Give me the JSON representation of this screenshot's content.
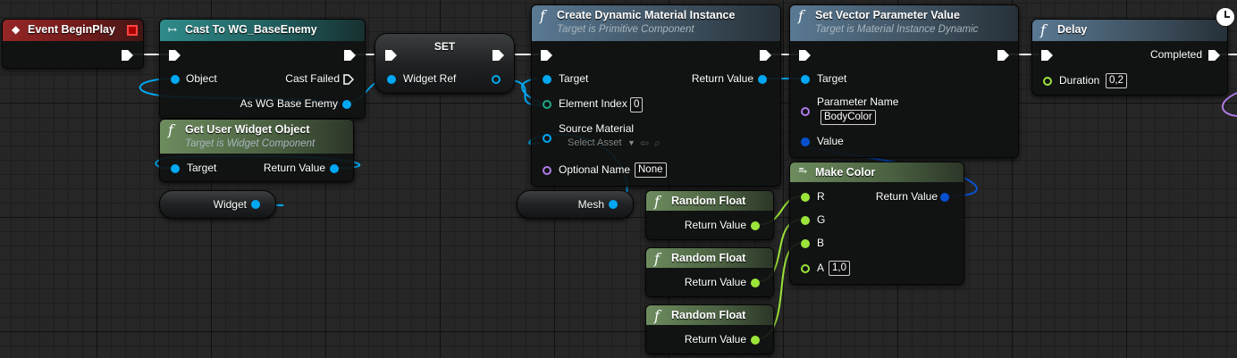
{
  "event_begin_play": {
    "title": "Event BeginPlay"
  },
  "cast_node": {
    "title": "Cast To WG_BaseEnemy",
    "object_label": "Object",
    "cast_failed_label": "Cast Failed",
    "as_enemy_label": "As WG Base Enemy"
  },
  "set_node": {
    "title": "SET",
    "widget_ref_label": "Widget Ref"
  },
  "get_user_widget": {
    "title": "Get User Widget Object",
    "subtitle": "Target is Widget Component",
    "target_label": "Target",
    "return_label": "Return Value"
  },
  "widget_var": {
    "label": "Widget"
  },
  "create_dmi": {
    "title": "Create Dynamic Material Instance",
    "subtitle": "Target is Primitive Component",
    "target_label": "Target",
    "element_index_label": "Element Index",
    "element_index_value": "0",
    "source_material_label": "Source Material",
    "select_asset_text": "Select Asset",
    "optional_name_label": "Optional Name",
    "optional_name_value": "None",
    "return_label": "Return Value"
  },
  "mesh_var": {
    "label": "Mesh"
  },
  "set_vector_param": {
    "title": "Set Vector Parameter Value",
    "subtitle": "Target is Material Instance Dynamic",
    "target_label": "Target",
    "param_name_label": "Parameter Name",
    "param_name_value": "BodyColor",
    "value_label": "Value"
  },
  "random_float_1": {
    "title": "Random Float",
    "return_label": "Return Value"
  },
  "random_float_2": {
    "title": "Random Float",
    "return_label": "Return Value"
  },
  "random_float_3": {
    "title": "Random Float",
    "return_label": "Return Value"
  },
  "make_color": {
    "title": "Make Color",
    "r_label": "R",
    "g_label": "G",
    "b_label": "B",
    "a_label": "A",
    "a_value": "1,0",
    "return_label": "Return Value"
  },
  "delay_node": {
    "title": "Delay",
    "duration_label": "Duration",
    "duration_value": "0,2",
    "completed_label": "Completed"
  },
  "colors": {
    "object_pin": "#00a8f2",
    "struct_pin": "#0850d0",
    "float_pin": "#9ce43a",
    "int_pin": "#20a888",
    "name_pin": "#b07ae8",
    "function_header": "#5a7993",
    "pure_header": "#6d8c5e",
    "cast_header": "#2f8b8a",
    "event_header": "#952626"
  }
}
